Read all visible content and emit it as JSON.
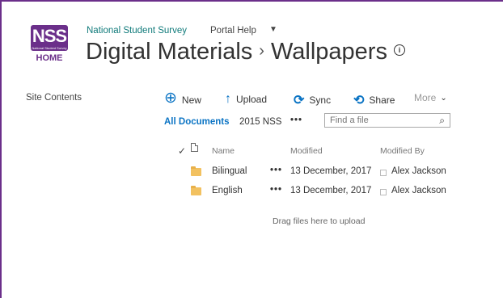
{
  "logo": {
    "mark": "NSS",
    "subtitle": "National Student Survey",
    "home": "HOME"
  },
  "topnav": {
    "site_link": "National Student Survey",
    "help_link": "Portal Help",
    "help_caret": "▼"
  },
  "breadcrumb": {
    "library": "Digital Materials",
    "separator": "›",
    "folder": "Wallpapers",
    "info_glyph": "i"
  },
  "sidebar": {
    "site_contents": "Site Contents"
  },
  "toolbar": {
    "new": {
      "icon": "⊕",
      "label": "New"
    },
    "upload": {
      "icon": "↑",
      "label": "Upload"
    },
    "sync": {
      "icon": "⟳",
      "label": "Sync"
    },
    "share": {
      "icon": "⟲",
      "label": "Share"
    },
    "more": {
      "label": "More",
      "chevron": "⌄"
    }
  },
  "views": {
    "all_documents": "All Documents",
    "view_2015": "2015 NSS",
    "more_dots": "•••"
  },
  "search": {
    "placeholder": "Find a file",
    "icon": "⌕"
  },
  "table": {
    "check_glyph": "✓",
    "headers": {
      "name": "Name",
      "modified": "Modified",
      "modified_by": "Modified By"
    },
    "rows": [
      {
        "name": "Bilingual",
        "dots": "•••",
        "modified": "13 December, 2017",
        "modified_by": "Alex Jackson"
      },
      {
        "name": "English",
        "dots": "•••",
        "modified": "13 December, 2017",
        "modified_by": "Alex Jackson"
      }
    ]
  },
  "drag_hint": "Drag files here to upload",
  "colors": {
    "brand": "#6b2f8a",
    "link": "#0b74c4",
    "site_link": "#0f7a7a",
    "folder": "#f2c160"
  }
}
